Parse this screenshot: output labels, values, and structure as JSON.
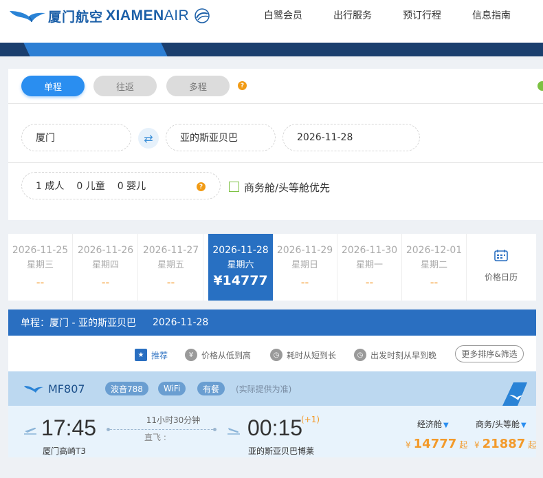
{
  "brand": {
    "name_cn": "厦门航空",
    "name_en_bold": "XIAMEN",
    "name_en_thin": "AIR",
    "logo_icon": "egret-bird-icon",
    "color": "#1b5fa8"
  },
  "nav": [
    "白鹭会员",
    "出行服务",
    "预订行程",
    "信息指南"
  ],
  "search": {
    "trip_types": [
      "单程",
      "往返",
      "多程"
    ],
    "active_trip_type": "单程",
    "from": "厦门",
    "to": "亚的斯亚贝巴",
    "date": "2026-11-28",
    "passengers": {
      "adults": "1 成人",
      "children": "0 儿童",
      "infants": "0 婴儿"
    },
    "cabin_pref_label": "商务舱/头等舱优先",
    "cabin_pref_checked": false
  },
  "date_strip": [
    {
      "date": "2026-11-25",
      "weekday": "星期三",
      "price": "--"
    },
    {
      "date": "2026-11-26",
      "weekday": "星期四",
      "price": "--"
    },
    {
      "date": "2026-11-27",
      "weekday": "星期五",
      "price": "--"
    },
    {
      "date": "2026-11-28",
      "weekday": "星期六",
      "price": "¥14777",
      "active": true
    },
    {
      "date": "2026-11-29",
      "weekday": "星期日",
      "price": "--"
    },
    {
      "date": "2026-11-30",
      "weekday": "星期一",
      "price": "--"
    },
    {
      "date": "2026-12-01",
      "weekday": "星期二",
      "price": "--"
    }
  ],
  "price_calendar_label": "价格日历",
  "route_bar": {
    "label": "单程：厦门 - 亚的斯亚贝巴",
    "date": "2026-11-28"
  },
  "sort": {
    "options": [
      "推荐",
      "价格从低到高",
      "耗时从短到长",
      "出发时刻从早到晚"
    ],
    "active": "推荐",
    "more_label": "更多排序&筛选"
  },
  "flight": {
    "number": "MF807",
    "tags": [
      "波音788",
      "WiFi",
      "有餐"
    ],
    "note": "(实际提供为准)",
    "departure_time": "17:45",
    "departure_airport": "厦门高崎T3",
    "duration": "11小时30分钟",
    "stop_type": "直飞 :",
    "arrival_time": "00:15",
    "day_offset": "(+1)",
    "arrival_airport": "亚的斯亚贝巴博莱",
    "fares": [
      {
        "cabin": "经济舱",
        "currency": "¥",
        "amount": "14777",
        "suffix": "起"
      },
      {
        "cabin": "商务/头等舱",
        "currency": "¥",
        "amount": "21887",
        "suffix": "起"
      }
    ]
  },
  "colors": {
    "primary_blue": "#2a8ef0",
    "route_bar": "#2a6fc1",
    "price_orange": "#f39a2a",
    "banner": "#1b3f6e"
  }
}
